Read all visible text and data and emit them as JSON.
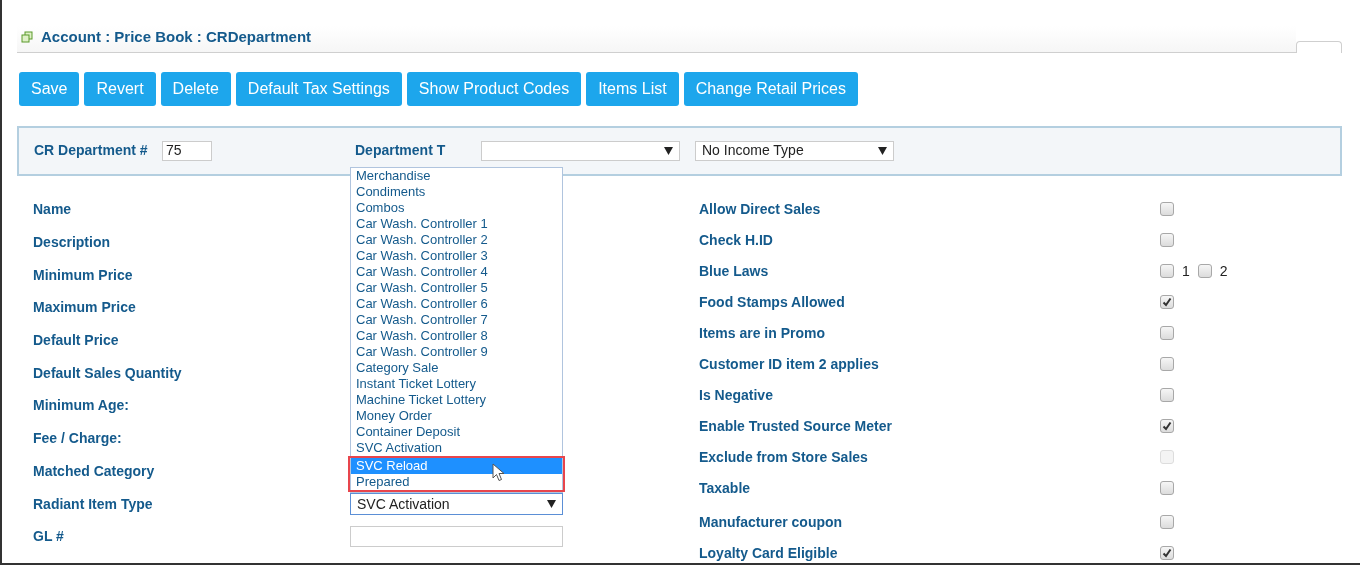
{
  "title": "Account : Price Book : CRDepartment",
  "buttons": [
    "Save",
    "Revert",
    "Delete",
    "Default Tax Settings",
    "Show Product Codes",
    "Items List",
    "Change Retail Prices"
  ],
  "header": {
    "department_label": "CR Department #",
    "department_value": "75",
    "type_label": "Department T",
    "income_type": "No Income Type"
  },
  "left_fields": [
    {
      "label": "Name",
      "kind": "label"
    },
    {
      "label": "Description",
      "kind": "label"
    },
    {
      "label": "Minimum Price",
      "kind": "label"
    },
    {
      "label": "Maximum Price",
      "kind": "label"
    },
    {
      "label": "Default Price",
      "kind": "label"
    },
    {
      "label": "Default Sales Quantity",
      "kind": "label"
    },
    {
      "label": "Minimum Age:",
      "kind": "label"
    },
    {
      "label": "Fee / Charge:",
      "kind": "label"
    },
    {
      "label": "Matched Category",
      "kind": "label"
    },
    {
      "label": "Radiant Item Type",
      "kind": "select",
      "value": "SVC Activation"
    },
    {
      "label": "GL #",
      "kind": "input"
    }
  ],
  "dropdown_options": [
    {
      "label": "Merchandise",
      "selected": false,
      "highlighted": false
    },
    {
      "label": "Condiments",
      "selected": false,
      "highlighted": false
    },
    {
      "label": "Combos",
      "selected": false,
      "highlighted": false
    },
    {
      "label": "Car Wash. Controller 1",
      "selected": false,
      "highlighted": false
    },
    {
      "label": "Car Wash. Controller 2",
      "selected": false,
      "highlighted": false
    },
    {
      "label": "Car Wash. Controller 3",
      "selected": false,
      "highlighted": false
    },
    {
      "label": "Car Wash. Controller 4",
      "selected": false,
      "highlighted": false
    },
    {
      "label": "Car Wash. Controller 5",
      "selected": false,
      "highlighted": false
    },
    {
      "label": "Car Wash. Controller 6",
      "selected": false,
      "highlighted": false
    },
    {
      "label": "Car Wash. Controller 7",
      "selected": false,
      "highlighted": false
    },
    {
      "label": "Car Wash. Controller 8",
      "selected": false,
      "highlighted": false
    },
    {
      "label": "Car Wash. Controller 9",
      "selected": false,
      "highlighted": false
    },
    {
      "label": "Category Sale",
      "selected": false,
      "highlighted": false
    },
    {
      "label": "Instant Ticket Lottery",
      "selected": false,
      "highlighted": false
    },
    {
      "label": "Machine Ticket Lottery",
      "selected": false,
      "highlighted": false
    },
    {
      "label": "Money Order",
      "selected": false,
      "highlighted": false
    },
    {
      "label": "Container Deposit",
      "selected": false,
      "highlighted": false
    },
    {
      "label": "SVC Activation",
      "selected": false,
      "highlighted": false
    },
    {
      "label": "SVC Reload",
      "selected": true,
      "highlighted": true
    },
    {
      "label": "Prepared",
      "selected": false,
      "highlighted": true
    }
  ],
  "right_fields": [
    {
      "label": "Allow Direct Sales",
      "kind": "checkbox",
      "checked": false,
      "disabled": false
    },
    {
      "label": "Check H.ID",
      "kind": "checkbox",
      "checked": false,
      "disabled": false
    },
    {
      "label": "Blue Laws",
      "kind": "checkbox_group",
      "options": [
        {
          "label": "1",
          "checked": false
        },
        {
          "label": "2",
          "checked": false
        }
      ]
    },
    {
      "label": "Food Stamps Allowed",
      "kind": "checkbox",
      "checked": true,
      "disabled": false
    },
    {
      "label": "Items are in Promo",
      "kind": "checkbox",
      "checked": false,
      "disabled": false
    },
    {
      "label": "Customer ID item 2 applies",
      "kind": "checkbox",
      "checked": false,
      "disabled": false
    },
    {
      "label": "Is Negative",
      "kind": "checkbox",
      "checked": false,
      "disabled": false
    },
    {
      "label": "Enable Trusted Source Meter",
      "kind": "checkbox",
      "checked": true,
      "disabled": false
    },
    {
      "label": "Exclude from Store Sales",
      "kind": "checkbox",
      "checked": false,
      "disabled": true
    },
    {
      "label": "Taxable",
      "kind": "checkbox",
      "checked": false,
      "disabled": false
    },
    {
      "label": "Manufacturer coupon",
      "kind": "checkbox",
      "checked": false,
      "disabled": false
    },
    {
      "label": "Loyalty Card Eligible",
      "kind": "checkbox",
      "checked": true,
      "disabled": false
    }
  ]
}
